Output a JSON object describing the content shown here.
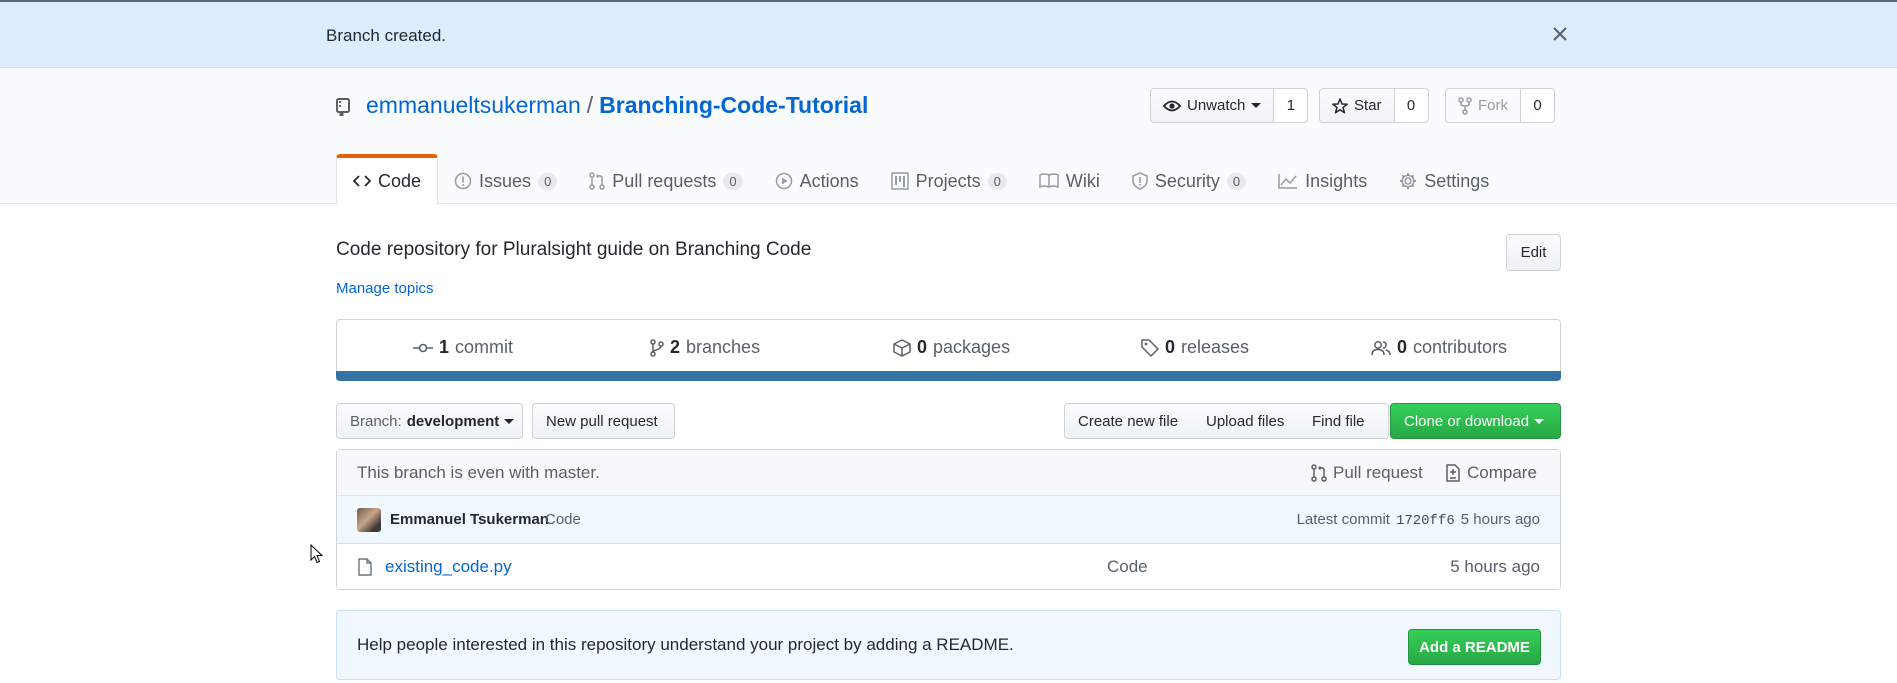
{
  "flash": {
    "message": "Branch created.",
    "close_icon": "x-icon"
  },
  "repo": {
    "owner": "emmanueltsukerman",
    "separator": "/",
    "name": "Branching-Code-Tutorial"
  },
  "actions": {
    "watch": {
      "label": "Unwatch",
      "count": "1"
    },
    "star": {
      "label": "Star",
      "count": "0"
    },
    "fork": {
      "label": "Fork",
      "count": "0"
    }
  },
  "tabs": [
    {
      "label": "Code",
      "count": null,
      "icon": "code-icon"
    },
    {
      "label": "Issues",
      "count": "0",
      "icon": "issue-icon"
    },
    {
      "label": "Pull requests",
      "count": "0",
      "icon": "pull-request-icon"
    },
    {
      "label": "Actions",
      "count": null,
      "icon": "play-icon"
    },
    {
      "label": "Projects",
      "count": "0",
      "icon": "project-icon"
    },
    {
      "label": "Wiki",
      "count": null,
      "icon": "book-icon"
    },
    {
      "label": "Security",
      "count": "0",
      "icon": "shield-icon"
    },
    {
      "label": "Insights",
      "count": null,
      "icon": "graph-icon"
    },
    {
      "label": "Settings",
      "count": null,
      "icon": "gear-icon"
    }
  ],
  "description": "Code repository for Pluralsight guide on Branching Code",
  "edit_label": "Edit",
  "manage_topics": "Manage topics",
  "summary": {
    "commits": {
      "num": "1",
      "label": "commit"
    },
    "branches": {
      "num": "2",
      "label": "branches"
    },
    "packages": {
      "num": "0",
      "label": "packages"
    },
    "releases": {
      "num": "0",
      "label": "releases"
    },
    "contributors": {
      "num": "0",
      "label": "contributors"
    }
  },
  "language_color": "#3572a5",
  "branch_select": {
    "prefix": "Branch:",
    "value": "development"
  },
  "new_pr": "New pull request",
  "file_buttons": {
    "create": "Create new file",
    "upload": "Upload files",
    "find": "Find file",
    "clone": "Clone or download"
  },
  "branch_status": {
    "text": "This branch is even with master.",
    "pull_request": "Pull request",
    "compare": "Compare"
  },
  "last_commit": {
    "author": "Emmanuel Tsukerman",
    "message": "Code",
    "prefix": "Latest commit",
    "sha": "1720ff6",
    "time": "5 hours ago"
  },
  "files": [
    {
      "name": "existing_code.py",
      "message": "Code",
      "age": "5 hours ago"
    }
  ],
  "readme_prompt": {
    "text": "Help people interested in this repository understand your project by adding a README.",
    "button": "Add a README"
  }
}
